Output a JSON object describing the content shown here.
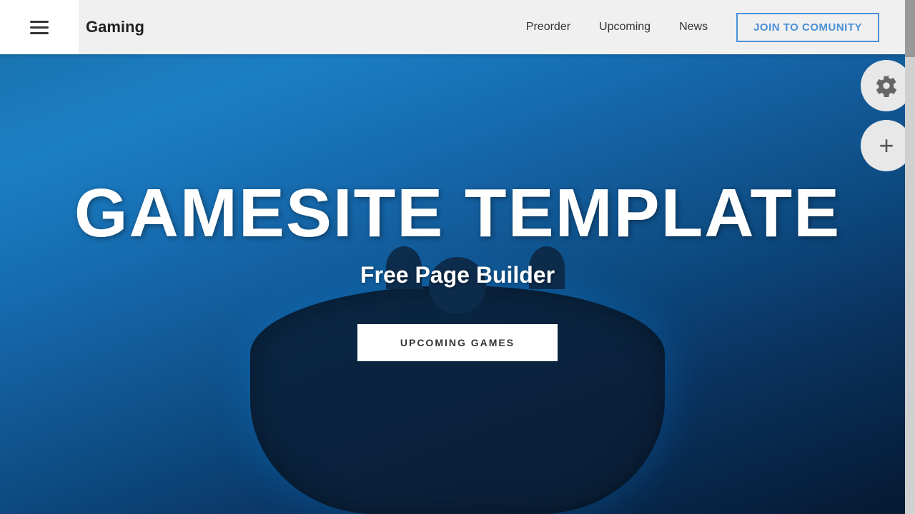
{
  "header": {
    "brand": "Gaming",
    "nav": {
      "preorder": "Preorder",
      "upcoming": "Upcoming",
      "news": "News",
      "join_btn": "JOIN TO COMUNITY"
    }
  },
  "hero": {
    "title": "GAMESITE TEMPLATE",
    "subtitle": "Free Page Builder",
    "cta_btn": "UPCOMING GAMES"
  },
  "floating": {
    "gear_label": "Settings",
    "plus_label": "Add"
  }
}
